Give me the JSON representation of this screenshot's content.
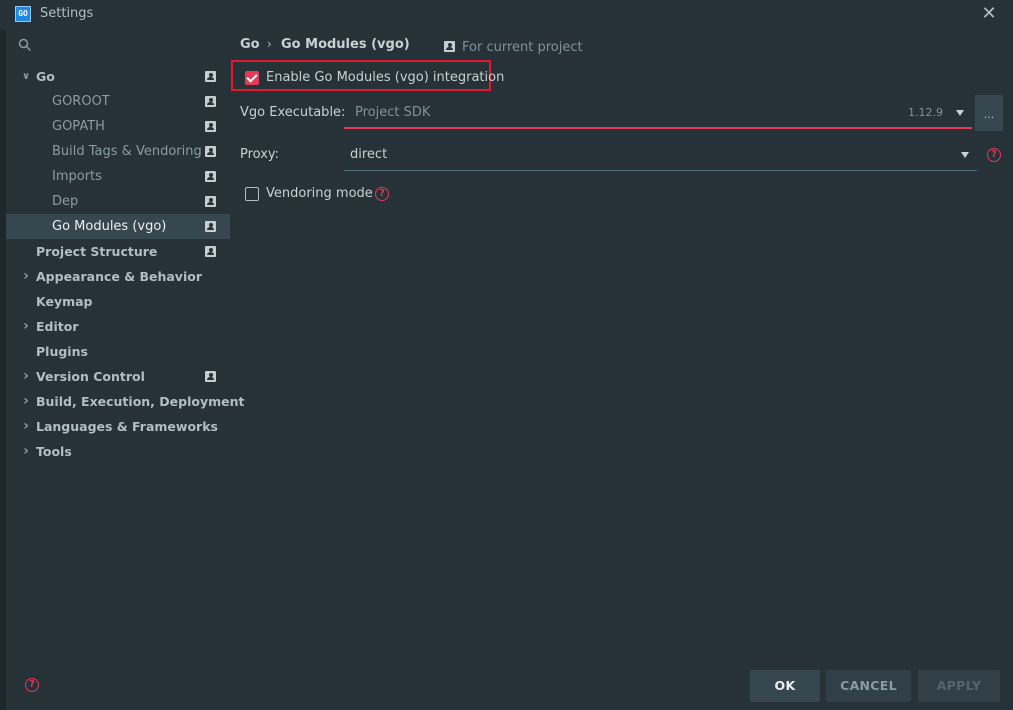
{
  "window": {
    "title": "Settings",
    "app_icon_text": "GO",
    "close_glyph": "✕"
  },
  "search": {
    "icon": "search-icon",
    "placeholder": ""
  },
  "sidebar": {
    "items": [
      {
        "label": "Go",
        "level": 0,
        "expandable": true,
        "expanded": true,
        "bold": true,
        "project_icon": true
      },
      {
        "label": "GOROOT",
        "level": 1,
        "project_icon": true
      },
      {
        "label": "GOPATH",
        "level": 1,
        "project_icon": true
      },
      {
        "label": "Build Tags & Vendoring",
        "level": 1,
        "project_icon": true
      },
      {
        "label": "Imports",
        "level": 1,
        "project_icon": true
      },
      {
        "label": "Dep",
        "level": 1,
        "project_icon": true
      },
      {
        "label": "Go Modules (vgo)",
        "level": 1,
        "project_icon": true,
        "selected": true
      },
      {
        "label": "Project Structure",
        "level": 0,
        "bold": true,
        "project_icon": true
      },
      {
        "label": "Appearance & Behavior",
        "level": 0,
        "expandable": true,
        "bold": true
      },
      {
        "label": "Keymap",
        "level": 0,
        "bold": true
      },
      {
        "label": "Editor",
        "level": 0,
        "expandable": true,
        "bold": true
      },
      {
        "label": "Plugins",
        "level": 0,
        "bold": true
      },
      {
        "label": "Version Control",
        "level": 0,
        "expandable": true,
        "bold": true,
        "project_icon": true
      },
      {
        "label": "Build, Execution, Deployment",
        "level": 0,
        "expandable": true,
        "bold": true
      },
      {
        "label": "Languages & Frameworks",
        "level": 0,
        "expandable": true,
        "bold": true
      },
      {
        "label": "Tools",
        "level": 0,
        "expandable": true,
        "bold": true
      }
    ]
  },
  "breadcrumb": {
    "parent": "Go",
    "separator": "›",
    "current": "Go Modules (vgo)",
    "scope_label": "For current project"
  },
  "settings": {
    "enable_label": "Enable Go Modules (vgo) integration",
    "enable_checked": true,
    "vgo_label": "Vgo Executable:",
    "vgo_value": "Project SDK",
    "vgo_version": "1.12.9",
    "browse_label": "...",
    "proxy_label": "Proxy:",
    "proxy_value": "direct",
    "vendoring_label": "Vendoring mode",
    "vendoring_checked": false,
    "help_glyph": "?"
  },
  "footer": {
    "ok": "OK",
    "cancel": "CANCEL",
    "apply": "APPLY"
  },
  "colors": {
    "background": "#263238",
    "accent": "#e53958",
    "highlight_border": "#e0192f",
    "selected_row": "#37474f"
  }
}
